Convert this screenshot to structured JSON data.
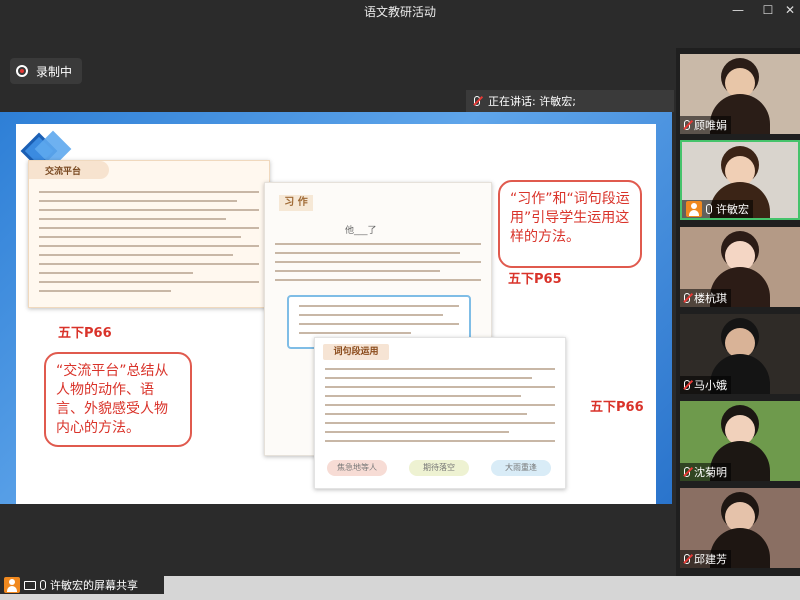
{
  "window": {
    "title": "语文教研活动",
    "minimize": "—",
    "maximize": "☐",
    "close": "✕"
  },
  "recording": {
    "label": "录制中"
  },
  "speaker": {
    "label": "正在讲话: 许敏宏;"
  },
  "slide": {
    "card_left_title": "交流平台",
    "card_mid_title": "习 作",
    "card_mid_subtitle": "他___了",
    "card_front_title": "词句段运用",
    "pills": [
      "焦急地等人",
      "期待落空",
      "大雨重逢"
    ],
    "callout_left": "“交流平台”总结从人物的动作、语言、外貌感受人物内心的方法。",
    "callout_right": "“习作”和“词句段运用”引导学生运用这样的方法。",
    "label_p66_left": "五下P66",
    "label_p65": "五下P65",
    "label_p66_right": "五下P66"
  },
  "participants": [
    {
      "name": "顾唯娟",
      "mic": "off",
      "active": false,
      "bg": "#c9b9a8",
      "skin": "#e8c6a8",
      "hair": "#2a1d17"
    },
    {
      "name": "许敏宏",
      "mic": "on",
      "active": true,
      "bg": "#d9d4cd",
      "skin": "#f0cfb5",
      "hair": "#3b2416"
    },
    {
      "name": "楼杭琪",
      "mic": "off",
      "active": false,
      "bg": "#b49a86",
      "skin": "#f4d6c4",
      "hair": "#2c1c16"
    },
    {
      "name": "马小娥",
      "mic": "off",
      "active": false,
      "bg": "#2f2b27",
      "skin": "#d9b397",
      "hair": "#141414"
    },
    {
      "name": "沈菊明",
      "mic": "off",
      "active": false,
      "bg": "#6e9a4c",
      "skin": "#f1d1bb",
      "hair": "#1c1713"
    },
    {
      "name": "邱建芳",
      "mic": "off",
      "active": false,
      "bg": "#8a6f63",
      "skin": "#e5c2aa",
      "hair": "#1e1612"
    }
  ],
  "share": {
    "label": "许敏宏的屏幕共享"
  },
  "colors": {
    "accent_red": "#d9332a",
    "active_border": "#46c36b",
    "slide_blue": "#2e7fd6"
  }
}
